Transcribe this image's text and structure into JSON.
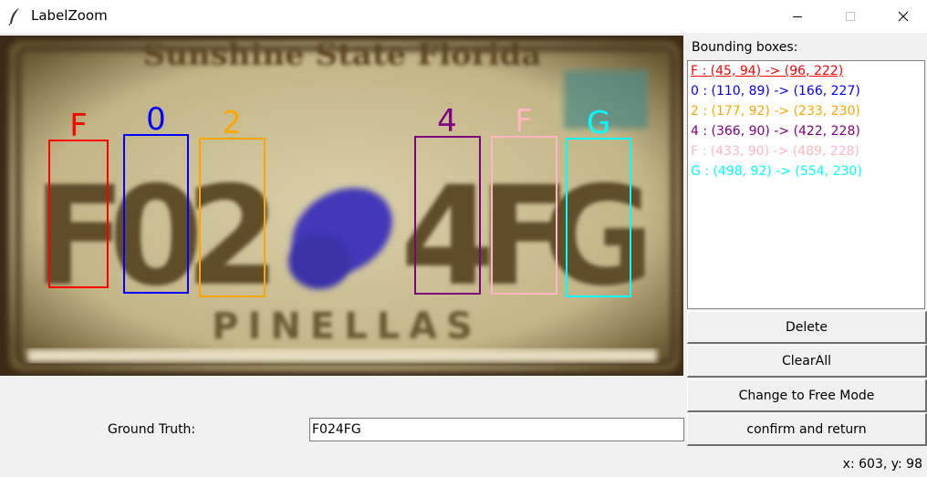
{
  "window": {
    "title": "LabelZoom"
  },
  "image": {
    "plate_header": "Sunshine State Florida",
    "plate_footer": "PINELLAS",
    "plate_chars": [
      "F",
      "0",
      "2",
      "4",
      "F",
      "G"
    ]
  },
  "annotations": [
    {
      "char": "F",
      "color": "#ff0000"
    },
    {
      "char": "0",
      "color": "#0000ff"
    },
    {
      "char": "2",
      "color": "#ffa500"
    },
    {
      "char": "4",
      "color": "#800080"
    },
    {
      "char": "F",
      "color": "#ffb6c1"
    },
    {
      "char": "G",
      "color": "#00ffff"
    }
  ],
  "panel": {
    "header": "Bounding boxes:",
    "items": [
      {
        "text": "F : (45, 94) -> (96, 222)",
        "color": "#ff0000",
        "selected": true
      },
      {
        "text": "0 : (110, 89) -> (166, 227)",
        "color": "#0000ff"
      },
      {
        "text": "2 : (177, 92) -> (233, 230)",
        "color": "#ffa500"
      },
      {
        "text": "4 : (366, 90) -> (422, 228)",
        "color": "#800080"
      },
      {
        "text": "F : (433, 90) -> (489, 228)",
        "color": "#ffb6c1"
      },
      {
        "text": "G : (498, 92) -> (554, 230)",
        "color": "#00ffff"
      }
    ]
  },
  "buttons": {
    "delete": "Delete",
    "clear_all": "ClearAll",
    "change_mode": "Change to Free Mode",
    "confirm": "confirm and return"
  },
  "ground_truth": {
    "label": "Ground Truth:",
    "value": "F024FG"
  },
  "status": {
    "coords": "x: 603, y: 98"
  }
}
